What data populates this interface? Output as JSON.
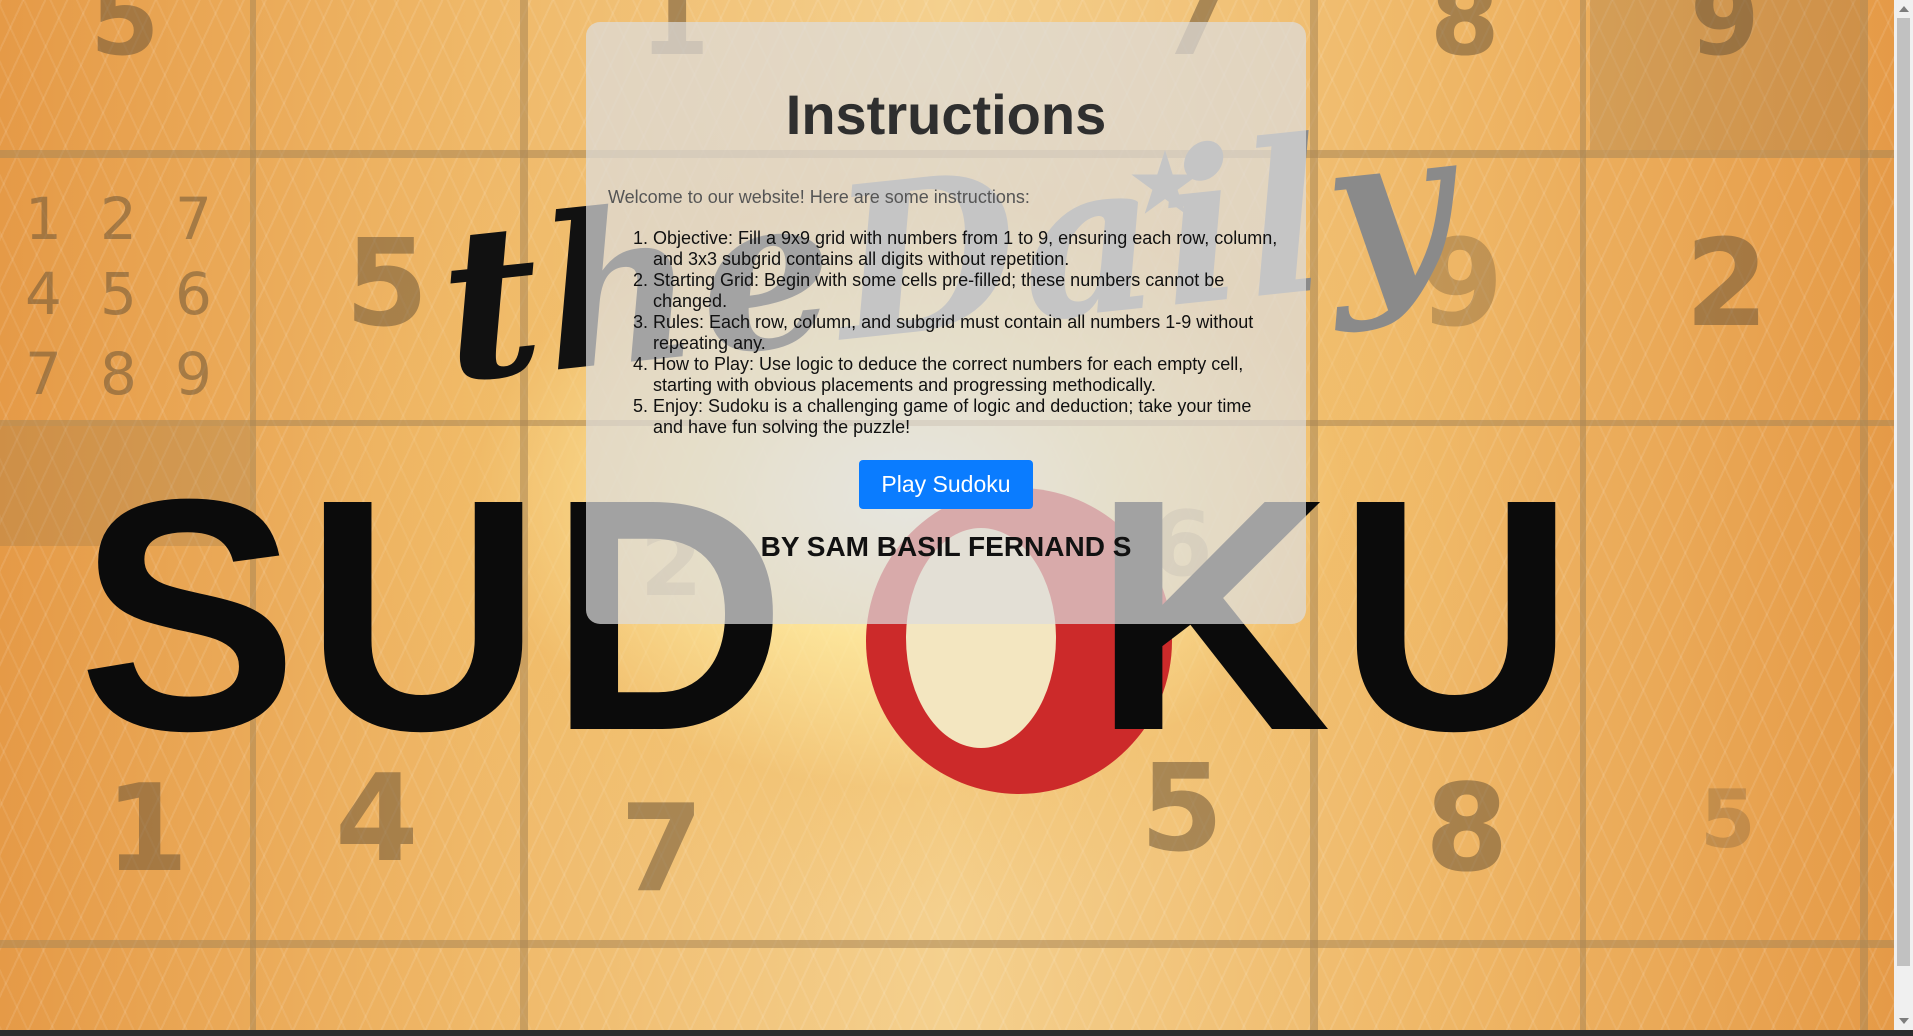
{
  "panel": {
    "title": "Instructions",
    "intro": "Welcome to our website! Here are some instructions:",
    "instructions": [
      "Objective: Fill a 9x9 grid with numbers from 1 to 9, ensuring each row, column, and 3x3 subgrid contains all digits without repetition.",
      "Starting Grid: Begin with some cells pre-filled; these numbers cannot be changed.",
      "Rules: Each row, column, and subgrid must contain all numbers 1-9 without repeating any.",
      "How to Play: Use logic to deduce the correct numbers for each empty cell, starting with obvious placements and progressing methodically.",
      "Enjoy: Sudoku is a challenging game of logic and deduction; take your time and have fun solving the puzzle!"
    ],
    "play_button": "Play Sudoku",
    "author": "BY SAM BASIL FERNAND S"
  },
  "background": {
    "logo_the": "the",
    "logo_daily": "Daily",
    "logo_sudoku_left": "SUD",
    "logo_sudoku_right": "KU",
    "digits_top": [
      "5",
      "1",
      "7",
      "8",
      "9"
    ],
    "candidates": [
      "1",
      "2",
      "7",
      "4",
      "5",
      "6",
      "7",
      "8",
      "9"
    ],
    "digits_mid": [
      "5",
      "9",
      "2",
      "6",
      "2"
    ],
    "digits_bottom": [
      "1",
      "4",
      "7",
      "5",
      "8",
      "5"
    ]
  },
  "colors": {
    "button": "#0a7cff",
    "logo_red": "#cc2a2a",
    "panel": "rgba(220,220,220,0.72)"
  }
}
